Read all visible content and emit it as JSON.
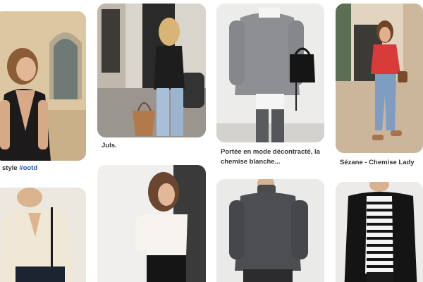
{
  "pins": [
    {
      "name": "pin-backless-black-dress",
      "caption_prefix": "style ",
      "caption_tag": "#ootd",
      "photo": "woman in black backless dress near arched door"
    },
    {
      "name": "pin-juls",
      "caption": "Juls.",
      "photo": "woman in black top and jeans holding tan bucket bag"
    },
    {
      "name": "pin-grey-sweater",
      "caption_line1": "Portée en mode décontracté, la",
      "caption_line2": "chemise blanche...",
      "photo": "grey sweater over white shirt with black bag"
    },
    {
      "name": "pin-sezane",
      "caption": "Sézane - Chemise Lady",
      "photo": "woman in red blouse and cropped jeans"
    },
    {
      "name": "pin-cream-blouse",
      "photo": "cream silk blouse with black bag strap"
    },
    {
      "name": "pin-white-blouse",
      "photo": "woman in white blouse and black trousers"
    },
    {
      "name": "pin-charcoal-turtleneck",
      "photo": "charcoal turtleneck sweater"
    },
    {
      "name": "pin-black-cardigan-stripes",
      "photo": "black cardigan over striped top"
    }
  ],
  "colors": {
    "caption": "#333333",
    "hashtag": "#1f58a8"
  }
}
